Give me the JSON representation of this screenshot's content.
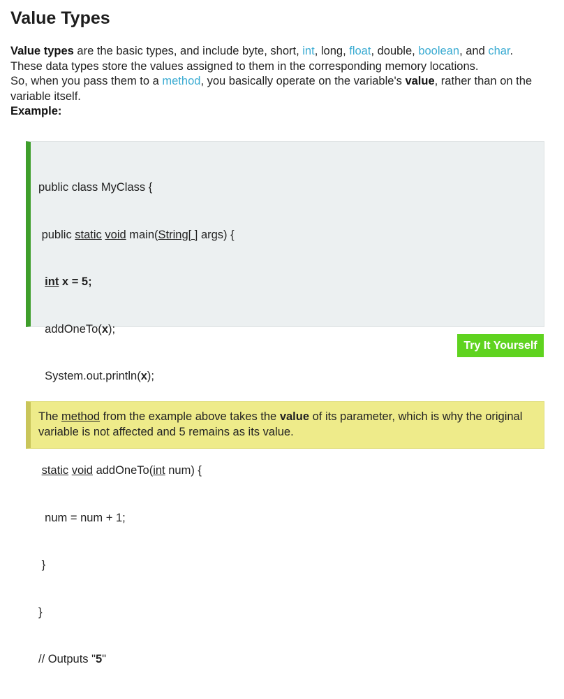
{
  "page": {
    "title": "Value Types"
  },
  "intro": {
    "line1": {
      "term": "Value types",
      "text_a": " are the basic types, and include byte, short, ",
      "link_int": "int",
      "text_b": ", long, ",
      "link_float": "float",
      "text_c": ", double, ",
      "link_boolean": "boolean",
      "text_d": ", and ",
      "link_char": "char",
      "text_e": "."
    },
    "line2": "These data types store the values assigned to them in the corresponding memory locations.",
    "line3": {
      "text_a": "So, when you pass them to a ",
      "link_method": "method",
      "text_b": ", you basically operate on the variable's ",
      "value_word": "value",
      "text_c": ", rather than on the variable itself."
    },
    "example_label": "Example:"
  },
  "code": {
    "l1": "public class MyClass {",
    "l2_pre": " public ",
    "l2_static": "static",
    "l2_sp1": " ",
    "l2_void": "void",
    "l2_mid": " main(",
    "l2_string": "String[ ]",
    "l2_post": " args) {",
    "l3_indent": "  ",
    "l3_int": "int",
    "l3_rest": " x = 5;",
    "l4_pre": "  addOneTo(",
    "l4_x": "x",
    "l4_post": ");",
    "l5_pre": "  System.out.println(",
    "l5_x": "x",
    "l5_post": ");",
    "l6": " }",
    "l7_indent": " ",
    "l7_static": "static",
    "l7_sp1": " ",
    "l7_void": "void",
    "l7_mid": " addOneTo(",
    "l7_int": "int",
    "l7_post": " num) {",
    "l8": "  num = num + 1;",
    "l9": " }",
    "l10": "}",
    "l11_pre": "// Outputs \"",
    "l11_val": "5",
    "l11_post": "\""
  },
  "try_button": {
    "label": "Try It Yourself"
  },
  "note": {
    "text_a": "The ",
    "method_word": "method",
    "text_b": " from the example above takes the ",
    "value_word": "value",
    "text_c": " of its parameter, which is why the original variable is not affected and 5 remains as its value."
  },
  "colors": {
    "link": "#3aabd2",
    "code_accent": "#3e9e2b",
    "code_bg": "#ecf0f1",
    "button_bg": "#5fd31f",
    "note_bg": "#eeeb8a",
    "note_accent": "#c9c55a"
  }
}
